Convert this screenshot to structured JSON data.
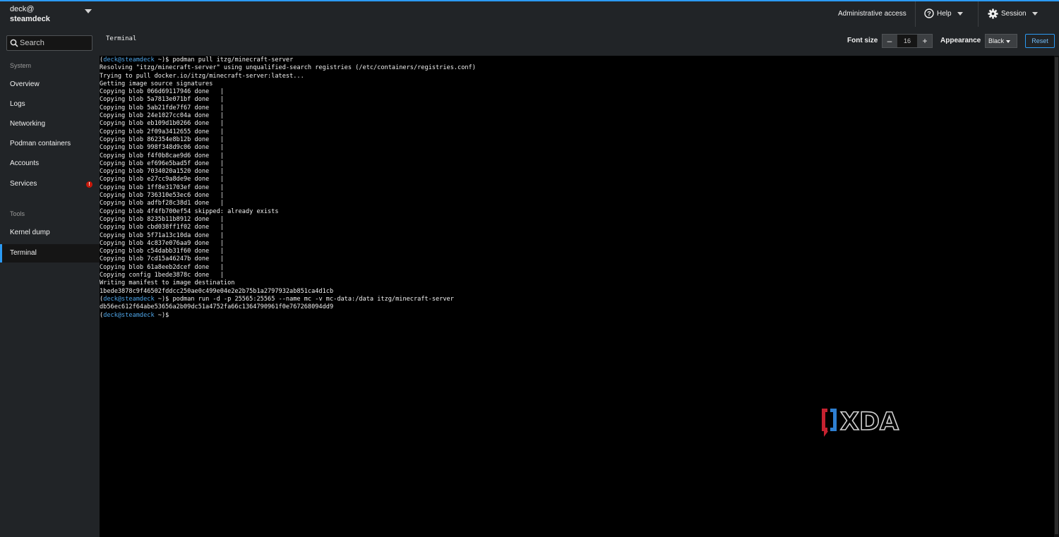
{
  "sidebar": {
    "user": "deck@",
    "host": "steamdeck",
    "search_placeholder": "Search",
    "sections": [
      {
        "title": "System",
        "items": [
          "Overview",
          "Logs",
          "Networking",
          "Podman containers",
          "Accounts",
          "Services"
        ]
      },
      {
        "title": "Tools",
        "items": [
          "Kernel dump",
          "Terminal"
        ]
      }
    ],
    "services_alert": "!",
    "active_item": "Terminal"
  },
  "topbar": {
    "admin": "Administrative access",
    "help": "Help",
    "session": "Session"
  },
  "toolbar": {
    "title": "Terminal",
    "font_size_label": "Font size",
    "font_size_value": "16",
    "decrement": "–",
    "increment": "+",
    "appearance_label": "Appearance",
    "appearance_value": "Black",
    "reset": "Reset"
  },
  "terminal": {
    "prompt": "(deck@steamdeck ~)$",
    "lines": [
      {
        "prompt": true,
        "text": " podman pull itzg/minecraft-server"
      },
      {
        "text": "Resolving \"itzg/minecraft-server\" using unqualified-search registries (/etc/containers/registries.conf)"
      },
      {
        "text": "Trying to pull docker.io/itzg/minecraft-server:latest..."
      },
      {
        "text": "Getting image source signatures"
      },
      {
        "text": "Copying blob 066d69117946 done   |"
      },
      {
        "text": "Copying blob 5a7813e071bf done   |"
      },
      {
        "text": "Copying blob 5ab21fde7f67 done   |"
      },
      {
        "text": "Copying blob 24e1027cc04a done   |"
      },
      {
        "text": "Copying blob eb109d1b0266 done   |"
      },
      {
        "text": "Copying blob 2f09a3412655 done   |"
      },
      {
        "text": "Copying blob 862354e8b12b done   |"
      },
      {
        "text": "Copying blob 998f348d9c06 done   |"
      },
      {
        "text": "Copying blob f4f0b8cae9d6 done   |"
      },
      {
        "text": "Copying blob ef696e5bad5f done   |"
      },
      {
        "text": "Copying blob 7034020a1520 done   |"
      },
      {
        "text": "Copying blob e27cc9a8de9e done   |"
      },
      {
        "text": "Copying blob 1ff8e31703ef done   |"
      },
      {
        "text": "Copying blob 736310e53ec6 done   |"
      },
      {
        "text": "Copying blob adfbf28c38d1 done   |"
      },
      {
        "text": "Copying blob 4f4fb700ef54 skipped: already exists"
      },
      {
        "text": "Copying blob 8235b11b8912 done   |"
      },
      {
        "text": "Copying blob cbd038ff1f02 done   |"
      },
      {
        "text": "Copying blob 5f71a13c10da done   |"
      },
      {
        "text": "Copying blob 4c837e076aa9 done   |"
      },
      {
        "text": "Copying blob c54dabb31f60 done   |"
      },
      {
        "text": "Copying blob 7cd15a46247b done   |"
      },
      {
        "text": "Copying blob 61a8eeb2dcef done   |"
      },
      {
        "text": "Copying config 1bede3878c done   |"
      },
      {
        "text": "Writing manifest to image destination"
      },
      {
        "text": "1bede3878c9f46502fddcc250ae0c499e04e2e2b75b1a2797932ab851ca4d1cb"
      },
      {
        "prompt": true,
        "text": " podman run -d -p 25565:25565 --name mc -v mc-data:/data itzg/minecraft-server"
      },
      {
        "text": "db56ec612f64abe53656a2b09dc51a4752fa66c1364790961f0e767268094dd9"
      },
      {
        "prompt": true,
        "text": ""
      }
    ]
  },
  "watermark": {
    "text": "XDA"
  }
}
